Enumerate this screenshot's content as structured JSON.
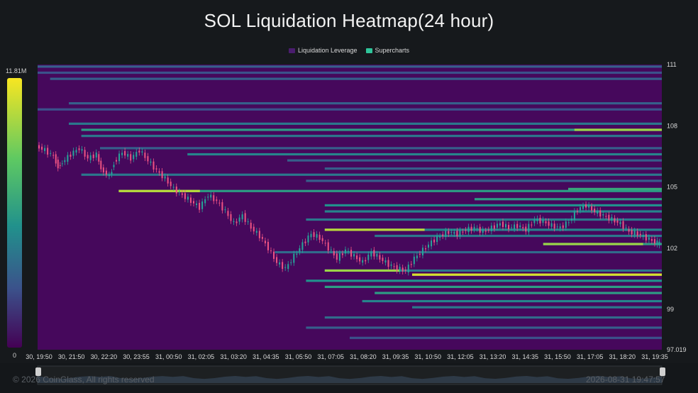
{
  "header": {
    "title": "SOL Liquidation Heatmap(24 hour)"
  },
  "legend": {
    "items": [
      {
        "label": "Liquidation Leverage",
        "color": "#4a1d6e"
      },
      {
        "label": "Supercharts",
        "color": "#2fc59a"
      }
    ]
  },
  "colorbar": {
    "max_label": "11.81M",
    "min_label": "0"
  },
  "footer": {
    "copyright": "© 2026 CoinGlass, All rights reserved",
    "timestamp": "2026-08-31 19:47:57"
  },
  "colors": {
    "background": "#16191c",
    "heat_low": "#440154",
    "heat_high": "#f8e621",
    "candle_up": "#26a69a",
    "candle_down": "#ef5383"
  },
  "chart_data": {
    "type": "heatmap",
    "title": "SOL Liquidation Heatmap(24 hour)",
    "y_ticks": [
      "111",
      "108",
      "105",
      "102",
      "99",
      "97.019"
    ],
    "y_tick_values": [
      111,
      108,
      105,
      102,
      99,
      97.019
    ],
    "ylim": [
      97.019,
      111
    ],
    "x_ticks": [
      "30, 19:50",
      "30, 21:50",
      "30, 22:20",
      "30, 23:55",
      "31, 00:50",
      "31, 02:05",
      "31, 03:20",
      "31, 04:35",
      "31, 05:50",
      "31, 07:05",
      "31, 08:20",
      "31, 09:35",
      "31, 10:50",
      "31, 12:05",
      "31, 13:20",
      "31, 14:35",
      "31, 15:50",
      "31, 17:05",
      "31, 18:20",
      "31, 19:35"
    ],
    "colorbar_range": [
      0,
      11810000
    ],
    "price_path": [
      [
        0,
        107.0
      ],
      [
        2,
        106.8
      ],
      [
        4,
        106.5
      ],
      [
        5,
        106.0
      ],
      [
        6,
        106.2
      ],
      [
        8,
        106.6
      ],
      [
        10,
        106.9
      ],
      [
        12,
        106.4
      ],
      [
        14,
        106.6
      ],
      [
        15,
        105.9
      ],
      [
        17,
        105.5
      ],
      [
        18,
        106.2
      ],
      [
        20,
        106.7
      ],
      [
        22,
        106.4
      ],
      [
        24,
        106.8
      ],
      [
        26,
        106.3
      ],
      [
        28,
        105.8
      ],
      [
        30,
        105.4
      ],
      [
        32,
        104.9
      ],
      [
        34,
        104.6
      ],
      [
        36,
        104.3
      ],
      [
        38,
        104.0
      ],
      [
        40,
        104.6
      ],
      [
        42,
        104.3
      ],
      [
        44,
        103.8
      ],
      [
        46,
        103.2
      ],
      [
        48,
        103.6
      ],
      [
        50,
        103.0
      ],
      [
        52,
        102.6
      ],
      [
        54,
        102.0
      ],
      [
        56,
        101.3
      ],
      [
        58,
        101.0
      ],
      [
        60,
        101.6
      ],
      [
        62,
        102.2
      ],
      [
        64,
        102.7
      ],
      [
        66,
        102.5
      ],
      [
        68,
        102.0
      ],
      [
        70,
        101.5
      ],
      [
        72,
        101.9
      ],
      [
        74,
        101.6
      ],
      [
        76,
        101.3
      ],
      [
        78,
        101.8
      ],
      [
        80,
        101.5
      ],
      [
        82,
        101.2
      ],
      [
        84,
        101.0
      ],
      [
        86,
        100.9
      ],
      [
        88,
        101.5
      ],
      [
        90,
        101.9
      ],
      [
        92,
        102.3
      ],
      [
        94,
        102.6
      ],
      [
        96,
        102.8
      ],
      [
        98,
        102.7
      ],
      [
        100,
        102.9
      ],
      [
        102,
        103.0
      ],
      [
        104,
        102.8
      ],
      [
        106,
        103.0
      ],
      [
        108,
        103.2
      ],
      [
        110,
        103.0
      ],
      [
        112,
        103.1
      ],
      [
        114,
        102.9
      ],
      [
        116,
        103.4
      ],
      [
        118,
        103.3
      ],
      [
        120,
        103.1
      ],
      [
        122,
        103.0
      ],
      [
        124,
        103.3
      ],
      [
        126,
        103.9
      ],
      [
        128,
        104.1
      ],
      [
        130,
        103.8
      ],
      [
        132,
        103.6
      ],
      [
        134,
        103.4
      ],
      [
        136,
        103.2
      ],
      [
        138,
        102.8
      ],
      [
        140,
        102.7
      ],
      [
        142,
        102.5
      ],
      [
        144,
        102.3
      ],
      [
        145,
        102.2
      ]
    ],
    "liquidation_levels": [
      {
        "price": 110.9,
        "start": 0.0,
        "intensity": 0.3
      },
      {
        "price": 110.6,
        "start": 0.0,
        "intensity": 0.25
      },
      {
        "price": 110.3,
        "start": 0.02,
        "intensity": 0.3
      },
      {
        "price": 109.1,
        "start": 0.05,
        "intensity": 0.3
      },
      {
        "price": 108.8,
        "start": 0.0,
        "intensity": 0.25
      },
      {
        "price": 108.1,
        "start": 0.05,
        "intensity": 0.4
      },
      {
        "price": 107.8,
        "start": 0.07,
        "intensity": 0.55,
        "hot_start": 0.86,
        "hot": 0.85
      },
      {
        "price": 107.5,
        "start": 0.07,
        "intensity": 0.4
      },
      {
        "price": 106.9,
        "start": 0.1,
        "intensity": 0.3
      },
      {
        "price": 106.6,
        "start": 0.24,
        "intensity": 0.45
      },
      {
        "price": 106.3,
        "start": 0.4,
        "intensity": 0.3
      },
      {
        "price": 105.9,
        "start": 0.46,
        "intensity": 0.3
      },
      {
        "price": 105.6,
        "start": 0.07,
        "intensity": 0.4
      },
      {
        "price": 105.3,
        "start": 0.43,
        "intensity": 0.3
      },
      {
        "price": 104.8,
        "start": 0.13,
        "intensity": 0.55,
        "hot_start": 0.13,
        "hot_end": 0.26,
        "hot": 0.9
      },
      {
        "price": 104.9,
        "start": 0.85,
        "intensity": 0.6
      },
      {
        "price": 104.4,
        "start": 0.7,
        "intensity": 0.55
      },
      {
        "price": 104.1,
        "start": 0.46,
        "intensity": 0.5
      },
      {
        "price": 103.8,
        "start": 0.46,
        "intensity": 0.45
      },
      {
        "price": 103.4,
        "start": 0.43,
        "intensity": 0.4
      },
      {
        "price": 102.9,
        "start": 0.46,
        "intensity": 0.45,
        "hot_start": 0.46,
        "hot_end": 0.62,
        "hot": 0.9
      },
      {
        "price": 102.6,
        "start": 0.54,
        "intensity": 0.4
      },
      {
        "price": 102.2,
        "start": 0.81,
        "intensity": 0.55,
        "hot_start": 0.81,
        "hot_end": 0.97,
        "hot": 0.85
      },
      {
        "price": 101.8,
        "start": 0.38,
        "intensity": 0.35
      },
      {
        "price": 100.9,
        "start": 0.46,
        "intensity": 0.4,
        "hot_start": 0.46,
        "hot_end": 0.58,
        "hot": 0.85
      },
      {
        "price": 100.7,
        "start": 0.6,
        "intensity": 0.65,
        "hot_start": 0.6,
        "hot_end": 1.0,
        "hot": 0.95
      },
      {
        "price": 100.4,
        "start": 0.43,
        "intensity": 0.5
      },
      {
        "price": 100.1,
        "start": 0.46,
        "intensity": 0.55
      },
      {
        "price": 99.8,
        "start": 0.54,
        "intensity": 0.55
      },
      {
        "price": 99.4,
        "start": 0.52,
        "intensity": 0.45
      },
      {
        "price": 99.1,
        "start": 0.6,
        "intensity": 0.4
      },
      {
        "price": 98.6,
        "start": 0.46,
        "intensity": 0.35
      },
      {
        "price": 98.1,
        "start": 0.43,
        "intensity": 0.3
      },
      {
        "price": 97.6,
        "start": 0.5,
        "intensity": 0.25
      }
    ]
  }
}
